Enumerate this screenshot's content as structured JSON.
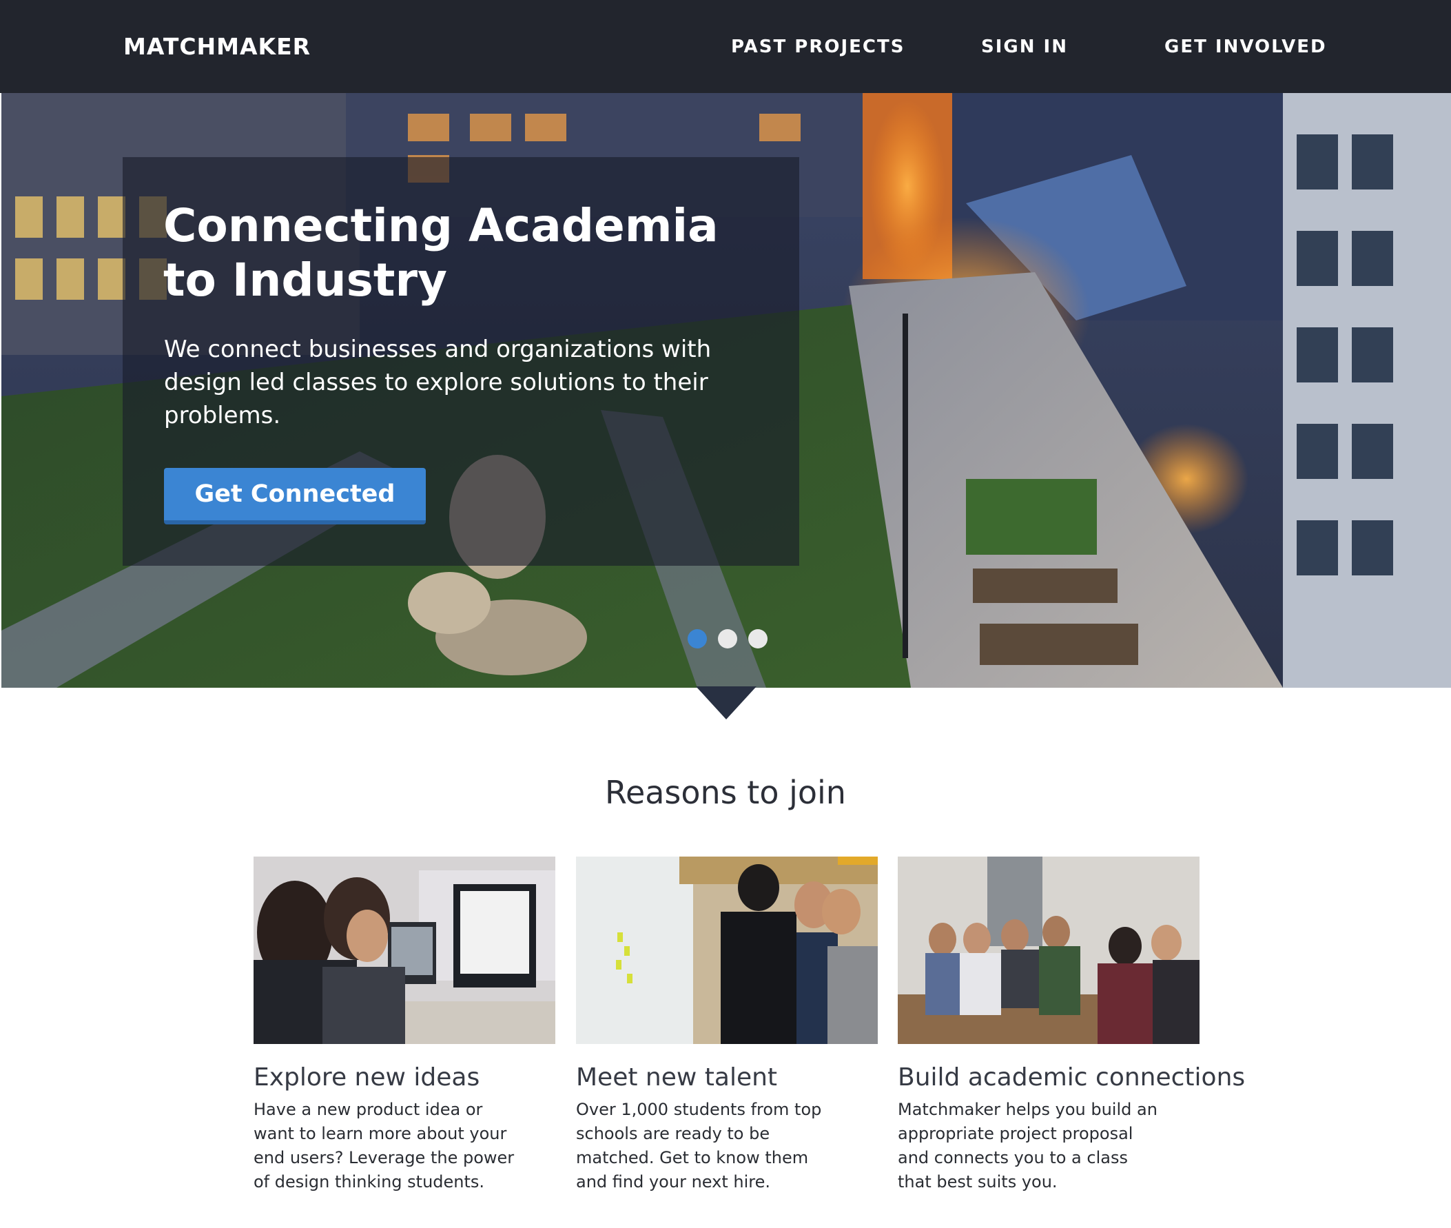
{
  "nav": {
    "logo": "MATCHMAKER",
    "links": [
      {
        "label": "PAST PROJECTS"
      },
      {
        "label": "SIGN IN"
      },
      {
        "label": "GET INVOLVED"
      }
    ],
    "background": "#22252d"
  },
  "hero": {
    "title": "Connecting Academia to Industry",
    "subtitle": "We connect businesses and organizations with design led classes to explore solutions to their problems.",
    "cta_label": "Get Connected",
    "cta_color": "#3b85d3",
    "carousel": {
      "slides": 3,
      "active_index": 0
    }
  },
  "reasons": {
    "title": "Reasons to join",
    "items": [
      {
        "title": "Explore new ideas",
        "text": "Have a new product idea or want to learn more about your end users? Leverage the power of design thinking students."
      },
      {
        "title": "Meet new talent",
        "text": "Over 1,000 students from top schools are ready to be matched. Get to know them and find your next hire."
      },
      {
        "title": "Build academic connections",
        "text": "Matchmaker helps you build an appropriate project proposal and connects you to a class that best suits you."
      }
    ]
  }
}
